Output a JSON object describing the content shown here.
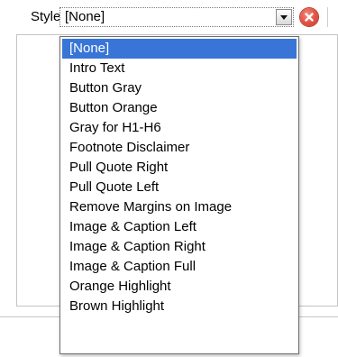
{
  "toolbar": {
    "style_label": "Style",
    "style_value": "[None]",
    "dropdown_arrow_icon": "chevron-down-icon",
    "clear_icon": "remove-x-icon"
  },
  "dropdown": {
    "selected_index": 0,
    "options": [
      "[None]",
      "Intro Text",
      "Button Gray",
      "Button Orange",
      "Gray for H1-H6",
      "Footnote Disclaimer",
      "Pull Quote Right",
      "Pull Quote Left",
      "Remove Margins on Image",
      "Image & Caption Left",
      "Image & Caption Right",
      "Image & Caption Full",
      "Orange Highlight",
      "Brown Highlight"
    ]
  },
  "colors": {
    "selection": "#3875d7",
    "clear_icon": "#e55a4a"
  }
}
